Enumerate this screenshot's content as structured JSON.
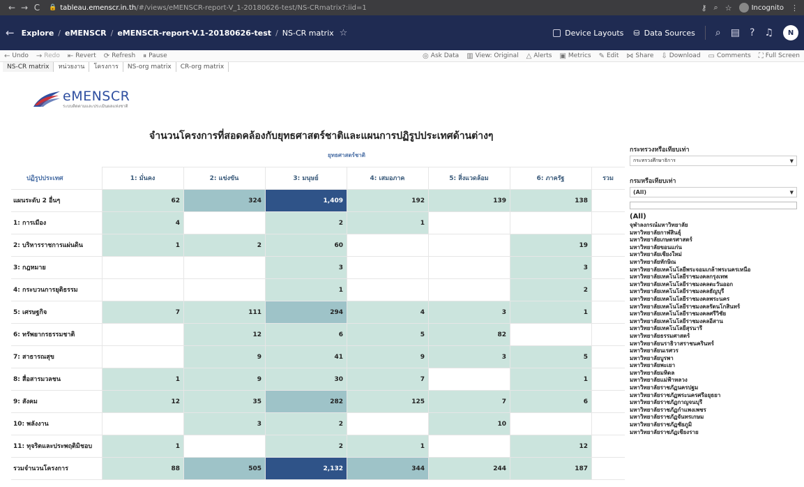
{
  "browser": {
    "host": "tableau.emenscr.in.th",
    "path": "/#/views/eMENSCR-report-V_1-20180626-test/NS-CRmatrix?:iid=1",
    "incognito": "Incognito"
  },
  "header": {
    "crumbs": [
      "Explore",
      "eMENSCR",
      "eMENSCR-report-V.1-20180626-test",
      "NS-CR matrix"
    ],
    "device_layouts": "Device Layouts",
    "data_sources": "Data Sources",
    "avatar": "N"
  },
  "toolbar": {
    "undo": "Undo",
    "redo": "Redo",
    "revert": "Revert",
    "refresh": "Refresh",
    "pause": "Pause",
    "ask_data": "Ask Data",
    "view_original": "View: Original",
    "alerts": "Alerts",
    "metrics": "Metrics",
    "edit": "Edit",
    "share": "Share",
    "download": "Download",
    "comments": "Comments",
    "full_screen": "Full Screen"
  },
  "sheet_tabs": [
    "NS-CR matrix",
    "หน่วยงาน",
    "โครงการ",
    "NS-org matrix",
    "CR-org matrix"
  ],
  "logo": {
    "main": "eMENSCR",
    "sub": "ระบบติดตามและประเมินผลแห่งชาติ"
  },
  "title": "จำนวนโครงการที่สอดคล้องกับยุทธศาสตร์ชาติและแผนการปฏิรูปประเทศด้านต่างๆ",
  "table": {
    "super_header": "ยุทธศาสตร์ชาติ",
    "row_header": "ปฏิรูปประเทศ",
    "columns": [
      "1: มั่นคง",
      "2: แข่งขัน",
      "3: มนุษย์",
      "4: เสมอภาค",
      "5: สิ่งแวดล้อม",
      "6: ภาครัฐ",
      "รวม"
    ],
    "rows": [
      {
        "label": "แผนระดับ 2 อื่นๆ",
        "values": [
          "62",
          "324",
          "1,409",
          "192",
          "139",
          "138",
          ""
        ]
      },
      {
        "label": "1: การเมือง",
        "values": [
          "4",
          "",
          "2",
          "1",
          "",
          "",
          ""
        ]
      },
      {
        "label": "2: บริหารราชการแผ่นดิน",
        "values": [
          "1",
          "2",
          "60",
          "",
          "",
          "19",
          ""
        ]
      },
      {
        "label": "3: กฎหมาย",
        "values": [
          "",
          "",
          "3",
          "",
          "",
          "3",
          ""
        ]
      },
      {
        "label": "4: กระบวนการยุติธรรม",
        "values": [
          "",
          "",
          "1",
          "",
          "",
          "2",
          ""
        ]
      },
      {
        "label": "5: เศรษฐกิจ",
        "values": [
          "7",
          "111",
          "294",
          "4",
          "3",
          "1",
          ""
        ]
      },
      {
        "label": "6: ทรัพยากรธรรมชาติ",
        "values": [
          "",
          "12",
          "6",
          "5",
          "82",
          "",
          ""
        ]
      },
      {
        "label": "7: สาธารณสุข",
        "values": [
          "",
          "9",
          "41",
          "9",
          "3",
          "5",
          ""
        ]
      },
      {
        "label": "8: สื่อสารมวลชน",
        "values": [
          "1",
          "9",
          "30",
          "7",
          "",
          "1",
          ""
        ]
      },
      {
        "label": "9: สังคม",
        "values": [
          "12",
          "35",
          "282",
          "125",
          "7",
          "6",
          ""
        ]
      },
      {
        "label": "10: พลังงาน",
        "values": [
          "",
          "3",
          "2",
          "",
          "10",
          "",
          ""
        ]
      },
      {
        "label": "11: ทุจริตและประพฤติมิชอบ",
        "values": [
          "1",
          "",
          "2",
          "1",
          "",
          "12",
          ""
        ]
      },
      {
        "label": "รวมจำนวนโครงการ",
        "values": [
          "88",
          "505",
          "2,132",
          "344",
          "244",
          "187",
          ""
        ]
      }
    ]
  },
  "filters": {
    "f1_title": "กระทรวงหรือเทียบเท่า",
    "f1_value": "กระทรวงศึกษาธิการ",
    "f2_title": "กรมหรือเทียบเท่า",
    "f2_value": "(All)",
    "list": [
      "(All)",
      "จุฬาลงกรณ์มหาวิทยาลัย",
      "มหาวิทยาลัยกาฬสินธุ์",
      "มหาวิทยาลัยเกษตรศาสตร์",
      "มหาวิทยาลัยขอนแก่น",
      "มหาวิทยาลัยเชียงใหม่",
      "มหาวิทยาลัยทักษิณ",
      "มหาวิทยาลัยเทคโนโลยีพระจอมเกล้าพระนครเหนือ",
      "มหาวิทยาลัยเทคโนโลยีราชมงคลกรุงเทพ",
      "มหาวิทยาลัยเทคโนโลยีราชมงคลตะวันออก",
      "มหาวิทยาลัยเทคโนโลยีราชมงคลธัญบุรี",
      "มหาวิทยาลัยเทคโนโลยีราชมงคลพระนคร",
      "มหาวิทยาลัยเทคโนโลยีราชมงคลรัตนโกสินทร์",
      "มหาวิทยาลัยเทคโนโลยีราชมงคลศรีวิชัย",
      "มหาวิทยาลัยเทคโนโลยีราชมงคลอีสาน",
      "มหาวิทยาลัยเทคโนโลยีสุรนารี",
      "มหาวิทยาลัยธรรมศาสตร์",
      "มหาวิทยาลัยนราธิวาสราชนครินทร์",
      "มหาวิทยาลัยนเรศวร",
      "มหาวิทยาลัยบูรพา",
      "มหาวิทยาลัยพะเยา",
      "มหาวิทยาลัยมหิดล",
      "มหาวิทยาลัยแม่ฟ้าหลวง",
      "มหาวิทยาลัยราชภัฏนครปฐม",
      "มหาวิทยาลัยราชภัฏพระนครศรีอยุธยา",
      "มหาวิทยาลัยราชภัฏกาญจนบุรี",
      "มหาวิทยาลัยราชภัฏกำแพงเพชร",
      "มหาวิทยาลัยราชภัฏจันทรเกษม",
      "มหาวิทยาลัยราชภัฏชัยภูมิ",
      "มหาวิทยาลัยราชภัฏเชียงราย"
    ]
  },
  "colors": {
    "dark": "#2f5388",
    "mid": "#9ec3c8",
    "light": "#cbe4dd"
  }
}
